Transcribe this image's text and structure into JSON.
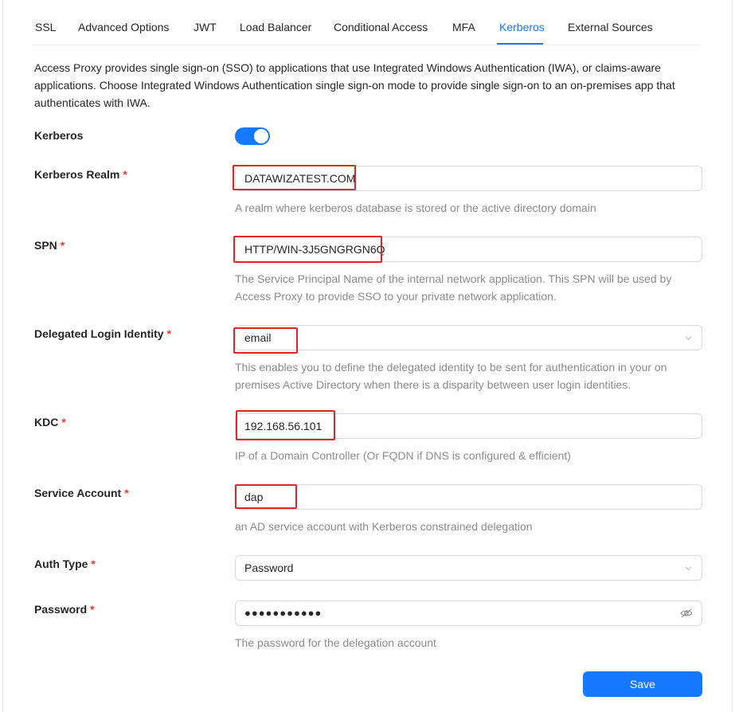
{
  "tabs": [
    {
      "label": "SSL"
    },
    {
      "label": "Advanced Options"
    },
    {
      "label": "JWT"
    },
    {
      "label": "Load Balancer"
    },
    {
      "label": "Conditional Access"
    },
    {
      "label": "MFA"
    },
    {
      "label": "Kerberos",
      "active": true
    },
    {
      "label": "External Sources"
    }
  ],
  "description": "Access Proxy provides single sign-on (SSO) to applications that use Integrated Windows Authentication (IWA), or claims-aware applications. Choose Integrated Windows Authentication single sign-on mode to provide single sign-on to an on-premises app that authenticates with IWA.",
  "form": {
    "kerberos": {
      "label": "Kerberos",
      "enabled": true
    },
    "realm": {
      "label": "Kerberos Realm",
      "required": "*",
      "value": "DATAWIZATEST.COM",
      "help": "A realm where kerberos database is stored or the active directory domain"
    },
    "spn": {
      "label": "SPN",
      "required": "*",
      "value": "HTTP/WIN-3J5GNGRGN6Q",
      "help": "The Service Principal Name of the internal network application. This SPN will be used by Access Proxy to provide SSO to your private network application."
    },
    "delegated_identity": {
      "label": "Delegated Login Identity",
      "required": "*",
      "value": "email",
      "help": "This enables you to define the delegated identity to be sent for authentication in your on premises Active Directory when there is a disparity between user login identities."
    },
    "kdc": {
      "label": "KDC",
      "required": "*",
      "value": "192.168.56.101",
      "help": "IP of a Domain Controller (Or FQDN if DNS is configured & efficient)"
    },
    "service_account": {
      "label": "Service Account",
      "required": "*",
      "value": "dap",
      "help": "an AD service account with Kerberos constrained delegation"
    },
    "auth_type": {
      "label": "Auth Type",
      "required": "*",
      "value": "Password"
    },
    "password": {
      "label": "Password",
      "required": "*",
      "masked_value": "●●●●●●●●●●●",
      "help": "The password for the delegation account"
    }
  },
  "actions": {
    "save_label": "Save"
  },
  "colors": {
    "accent": "#1677ff",
    "highlight": "#e0242a",
    "required": "#e53935"
  },
  "icons": [
    "chevron-down-icon",
    "eye-off-icon"
  ]
}
